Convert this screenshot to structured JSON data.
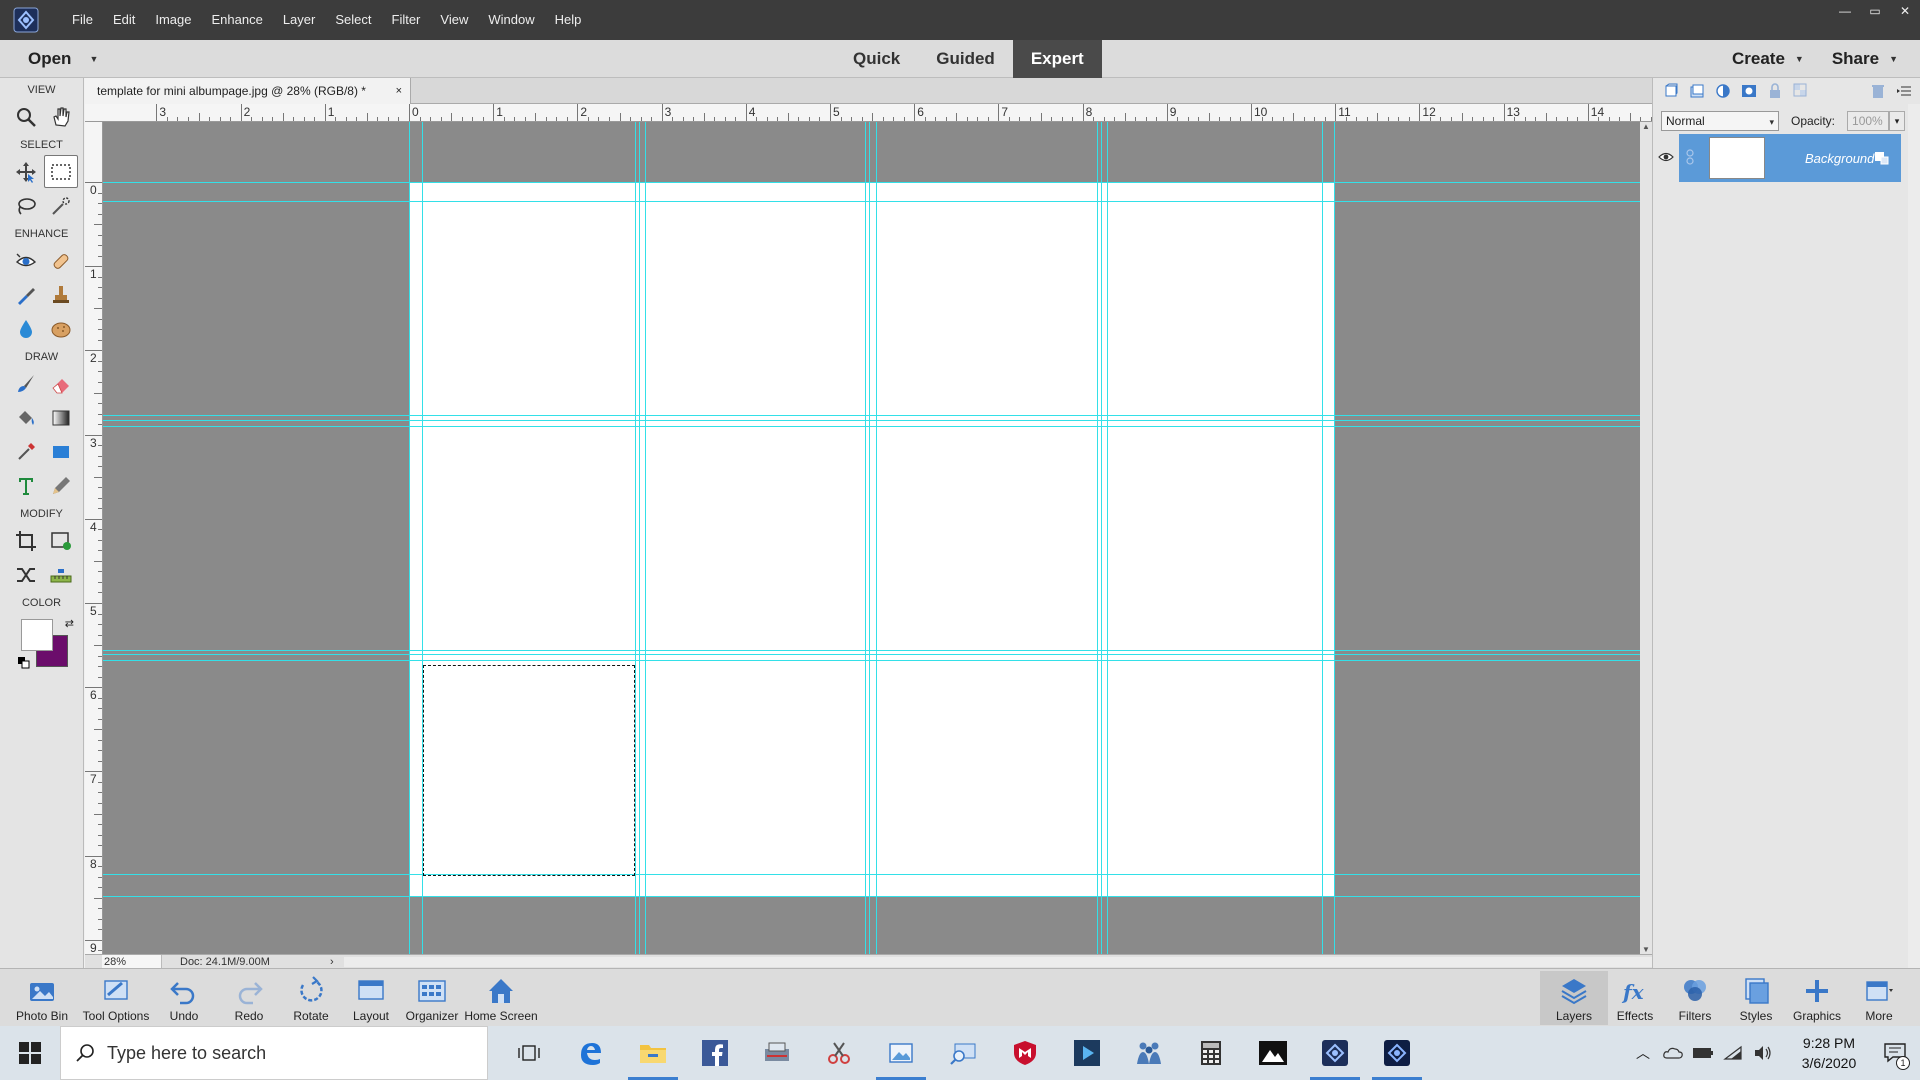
{
  "menu": {
    "items": [
      "File",
      "Edit",
      "Image",
      "Enhance",
      "Layer",
      "Select",
      "Filter",
      "View",
      "Window",
      "Help"
    ],
    "window_controls": [
      "—",
      "▭",
      "✕"
    ]
  },
  "modebar": {
    "open_label": "Open",
    "tabs": [
      "Quick",
      "Guided",
      "Expert"
    ],
    "active_tab": "Expert",
    "create_label": "Create",
    "share_label": "Share"
  },
  "toolbox": {
    "sections": {
      "view": "VIEW",
      "select": "SELECT",
      "enhance": "ENHANCE",
      "draw": "DRAW",
      "modify": "MODIFY",
      "color": "COLOR"
    },
    "foreground_color": "#ffffff",
    "background_color": "#6b0d6b"
  },
  "document": {
    "tab_title": "template for mini albumpage.jpg @ 28% (RGB/8) *",
    "tab_close": "×",
    "ruler_h_labels": [
      "3",
      "2",
      "1",
      "0",
      "1",
      "2",
      "3",
      "4",
      "5",
      "6",
      "7",
      "8",
      "9",
      "10",
      "11",
      "12",
      "13",
      "14"
    ],
    "ruler_v_labels": [
      "0",
      "1",
      "2",
      "3",
      "4",
      "5",
      "6",
      "7",
      "8",
      "9"
    ],
    "guide_color": "#33e0e8"
  },
  "statusbar": {
    "zoom": "28%",
    "doc_info": "Doc: 24.1M/9.00M",
    "arrow": "›"
  },
  "layers_panel": {
    "blend_mode": "Normal",
    "opacity_label": "Opacity:",
    "opacity_value": "100%",
    "layer_name": "Background"
  },
  "bottombar": {
    "left": [
      "Photo Bin",
      "Tool Options",
      "Undo",
      "Redo",
      "Rotate",
      "Layout",
      "Organizer",
      "Home Screen"
    ],
    "right": [
      "Layers",
      "Effects",
      "Filters",
      "Styles",
      "Graphics",
      "More"
    ],
    "active": "Layers"
  },
  "taskbar": {
    "search_placeholder": "Type here to search",
    "time": "9:28 PM",
    "date": "3/6/2020",
    "notification_count": "1"
  }
}
